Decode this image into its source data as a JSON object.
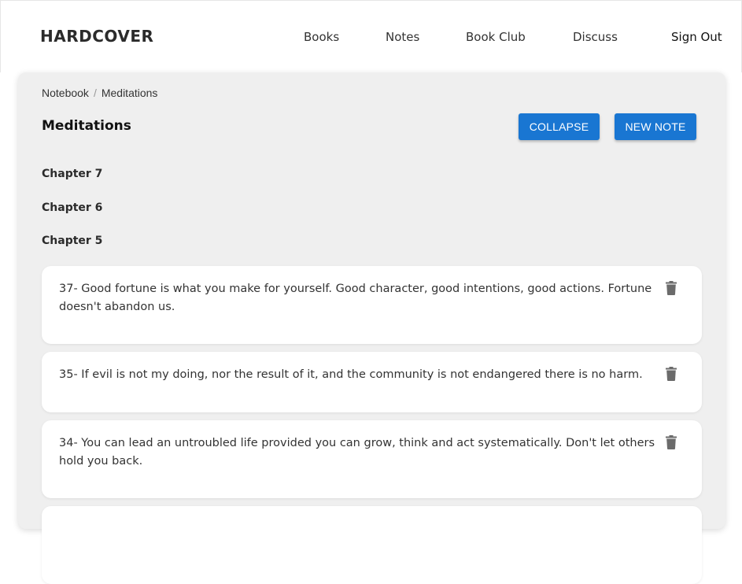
{
  "header": {
    "brand": "HARDCOVER",
    "nav": {
      "books": "Books",
      "notes": "Notes",
      "book_club": "Book Club",
      "discuss": "Discuss",
      "sign_out": "Sign Out"
    }
  },
  "breadcrumb": {
    "root": "Notebook",
    "separator": "/",
    "current": "Meditations"
  },
  "page": {
    "title": "Meditations",
    "collapse_label": "COLLAPSE",
    "new_note_label": "NEW NOTE"
  },
  "chapters": [
    "Chapter 7",
    "Chapter 6",
    "Chapter 5"
  ],
  "notes": [
    {
      "text": "37- Good fortune is what you make for yourself. Good character, good intentions, good actions. Fortune doesn't abandon us.",
      "icon": "trash-icon"
    },
    {
      "text": "35- If evil is not my doing, nor the result of it, and the community is not endangered there is no harm.",
      "icon": "trash-icon"
    },
    {
      "text": "34- You can lead an untroubled life provided you can grow, think and act systematically. Don't let others hold you back.",
      "icon": "trash-icon"
    }
  ],
  "colors": {
    "accent": "#1976d2",
    "panel": "#efefef",
    "card": "#ffffff",
    "icon": "#6b6b6b"
  }
}
